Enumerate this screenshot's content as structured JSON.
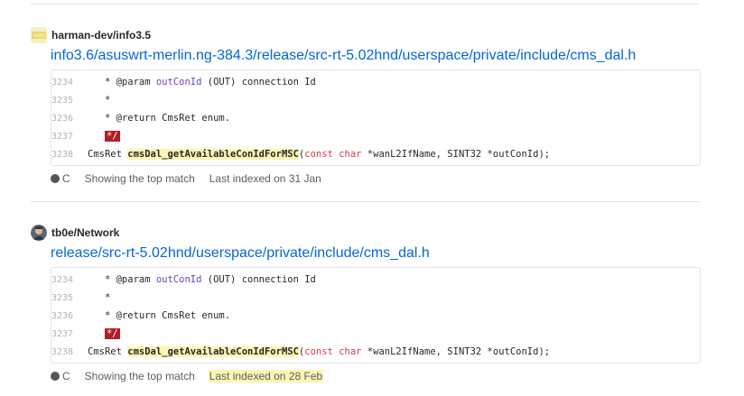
{
  "results": [
    {
      "repo": "harman-dev/info3.5",
      "path": "info3.6/asuswrt-merlin.ng-384.3/release/src-rt-5.02hnd/userspace/private/include/cms_dal.h",
      "lines": [
        {
          "num": "3234",
          "parts": [
            {
              "t": "   * @param ",
              "c": "plain"
            },
            {
              "t": "outConId",
              "c": "param"
            },
            {
              "t": " (OUT) connection Id",
              "c": "plain"
            }
          ]
        },
        {
          "num": "3235",
          "parts": [
            {
              "t": "   *",
              "c": "plain"
            }
          ]
        },
        {
          "num": "3236",
          "parts": [
            {
              "t": "   * @return CmsRet enum.",
              "c": "plain"
            }
          ]
        },
        {
          "num": "3237",
          "parts": [
            {
              "t": "   ",
              "c": "plain"
            },
            {
              "t": "*/",
              "c": "err"
            }
          ]
        },
        {
          "num": "3238",
          "parts": [
            {
              "t": "CmsRet ",
              "c": "plain"
            },
            {
              "t": "cmsDal_getAvailableConIdForMSC",
              "c": "hl"
            },
            {
              "t": "(",
              "c": "plain"
            },
            {
              "t": "const",
              "c": "kw"
            },
            {
              "t": " ",
              "c": "plain"
            },
            {
              "t": "char",
              "c": "kw"
            },
            {
              "t": " *wanL2IfName, SINT32 *outConId);",
              "c": "plain"
            }
          ]
        }
      ],
      "language": "C",
      "match_text": "Showing the top match",
      "indexed_text": "Last indexed on 31 Jan",
      "indexed_highlight": false
    },
    {
      "repo": "tb0e/Network",
      "path": "release/src-rt-5.02hnd/userspace/private/include/cms_dal.h",
      "lines": [
        {
          "num": "3234",
          "parts": [
            {
              "t": "   * @param ",
              "c": "plain"
            },
            {
              "t": "outConId",
              "c": "param"
            },
            {
              "t": " (OUT) connection Id",
              "c": "plain"
            }
          ]
        },
        {
          "num": "3235",
          "parts": [
            {
              "t": "   *",
              "c": "plain"
            }
          ]
        },
        {
          "num": "3236",
          "parts": [
            {
              "t": "   * @return CmsRet enum.",
              "c": "plain"
            }
          ]
        },
        {
          "num": "3237",
          "parts": [
            {
              "t": "   ",
              "c": "plain"
            },
            {
              "t": "*/",
              "c": "err"
            }
          ]
        },
        {
          "num": "3238",
          "parts": [
            {
              "t": "CmsRet ",
              "c": "plain"
            },
            {
              "t": "cmsDal_getAvailableConIdForMSC",
              "c": "hl"
            },
            {
              "t": "(",
              "c": "plain"
            },
            {
              "t": "const",
              "c": "kw"
            },
            {
              "t": " ",
              "c": "plain"
            },
            {
              "t": "char",
              "c": "kw"
            },
            {
              "t": " *wanL2IfName, SINT32 *outConId);",
              "c": "plain"
            }
          ]
        }
      ],
      "language": "C",
      "match_text": "Showing the top match",
      "indexed_text": "Last indexed on 28 Feb",
      "indexed_highlight": true
    }
  ],
  "colors": {
    "link": "#0366d6",
    "highlight": "#fff5b1",
    "error_bg": "#b31d28",
    "keyword": "#d73a49",
    "param": "#6f42c1",
    "lang_dot": "#555555"
  },
  "icons": {
    "result_0_avatar": "yellow-repo-avatar-icon",
    "result_1_avatar": "user-avatar-icon",
    "language_dot": "language-color-dot-icon"
  }
}
